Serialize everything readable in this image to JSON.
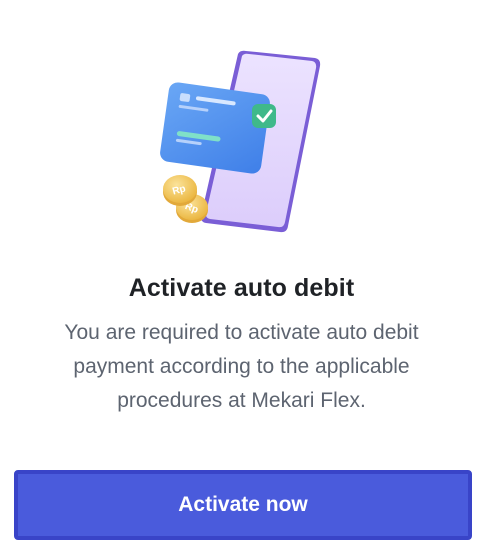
{
  "dialog": {
    "title": "Activate auto debit",
    "description": "You are required to activate auto debit payment according to the applicable procedures at Mekari Flex.",
    "primary_button_label": "Activate now"
  },
  "illustration": {
    "name": "phone-card-coins-illustration",
    "coin_label": "Rp",
    "colors": {
      "phone_frame": "#8f76e0",
      "phone_screen": "#e6d9ff",
      "card": "#4b8fef",
      "check_badge": "#3fb98a",
      "coin": "#f2c14e"
    }
  },
  "colors": {
    "title": "#1f2226",
    "description": "#5d6470",
    "button_bg": "#4a5bdc",
    "button_border": "#3944c8",
    "button_text": "#ffffff"
  }
}
